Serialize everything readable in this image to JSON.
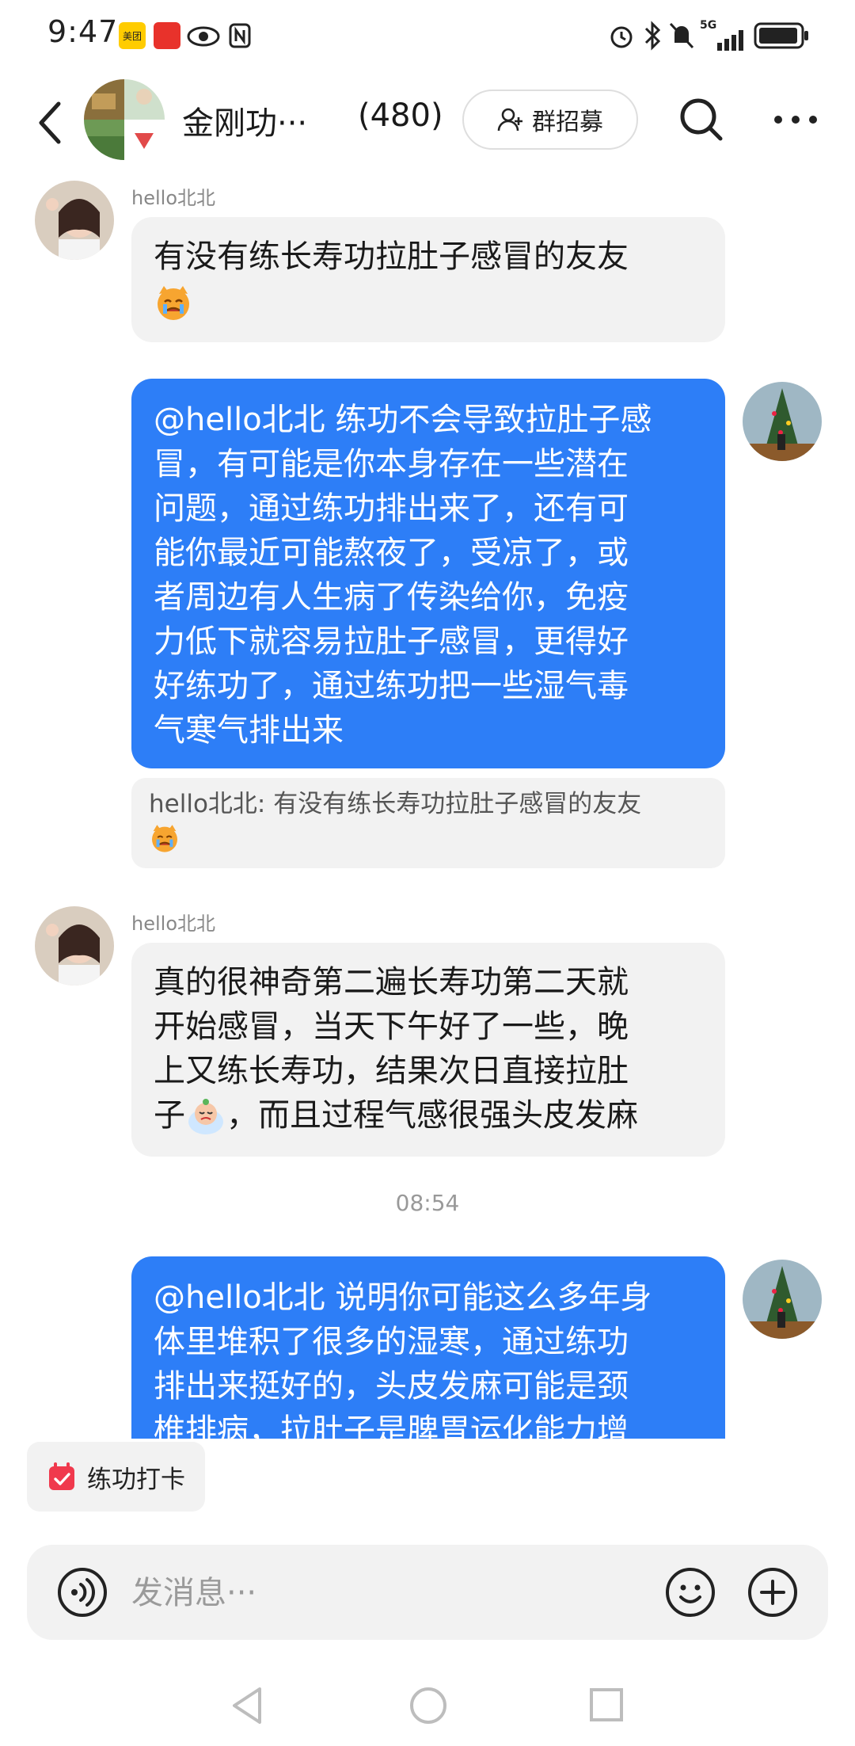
{
  "status_bar": {
    "time": "9:47",
    "app_badge_1": "美团",
    "network": "5G"
  },
  "header": {
    "group_name": "金刚功···",
    "member_count": "(480)",
    "recruit_label": "群招募"
  },
  "messages": [
    {
      "sender": "hello北北",
      "text": "有没有练长寿功拉肚子感冒的友友",
      "emoji": "cat-cry-icon"
    },
    {
      "text_lines": [
        "@hello北北  练功不会导致拉肚子感",
        "冒，有可能是你本身存在一些潜在",
        "问题，通过练功排出来了，还有可",
        "能你最近可能熬夜了，受凉了，或",
        "者周边有人生病了传染给你，免疫",
        "力低下就容易拉肚子感冒，更得好",
        "好练功了，通过练功把一些湿气毒",
        "气寒气排出来"
      ],
      "quote": "hello北北: 有没有练长寿功拉肚子感冒的友友"
    },
    {
      "sender": "hello北北",
      "text_lines": [
        "真的很神奇第二遍长寿功第二天就",
        "开始感冒，当天下午好了一些，晚",
        "上又练长寿功，结果次日直接拉肚",
        "，而且过程气感很强头皮发麻"
      ],
      "line4_prefix": "子"
    },
    {
      "timestamp": "08:54"
    },
    {
      "text_lines": [
        "@hello北北  说明你可能这么多年身",
        "体里堆积了很多的湿寒，通过练功",
        "排出来挺好的，头皮发麻可能是颈",
        "椎排病，拉肚子是脾胃运化能力增"
      ]
    }
  ],
  "bottom": {
    "checkin_label": "练功打卡",
    "input_placeholder": "发消息···"
  },
  "colors": {
    "outgoing_bubble": "#2d7ef7",
    "incoming_bubble": "#f2f2f2",
    "checkin_icon": "#f0394d"
  }
}
